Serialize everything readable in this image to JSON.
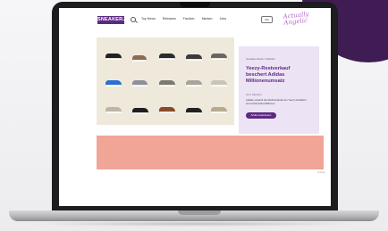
{
  "site": {
    "logo_text": "SNEAKERJAGD",
    "script_logo": "Actually Angelic",
    "nav_items": [
      "Top News",
      "Releases",
      "Fashion",
      "Marken",
      "Jobs"
    ],
    "cta_label": "Info",
    "brand_color": "#5c2a82",
    "accent_color": "#3f1d54"
  },
  "hero": {
    "eyebrow": "Sneaker-News / Fashion",
    "headline": "Yeezy-Restverkauf beschert Adidas Millionenumsatz",
    "meta": "vor 2 Stunden",
    "excerpt": "Adidas verkauft die Restbestände der Yeezy Kollektion und erzielt dabei Millionen.",
    "read_more_label": "Artikel weiterlesen"
  },
  "ad": {
    "label": "Anzeige",
    "color": "#f0a596"
  },
  "icons": [
    "search-icon"
  ]
}
